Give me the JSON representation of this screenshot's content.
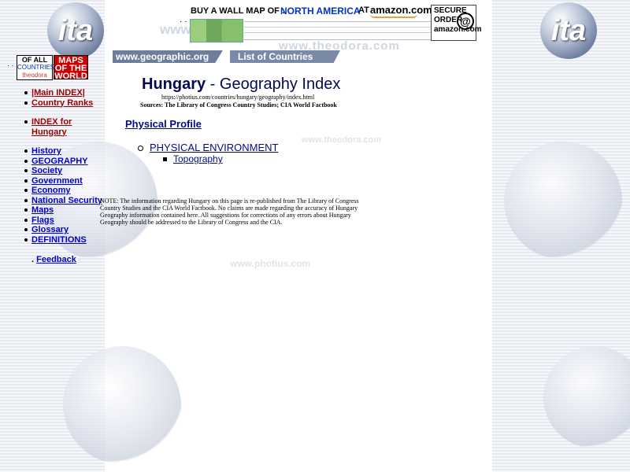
{
  "header": {
    "logo_text": "ita",
    "all_countries": {
      "line1": "OF ALL",
      "line2": "COUNTRIES",
      "line3": "theodora"
    },
    "maps_logo": {
      "line1": "MAPS",
      "line2": "OF THE",
      "line3": "WORLD"
    },
    "banner": {
      "buy_text": "BUY A WALL MAP OF :",
      "region": "NORTH AMERICA",
      "at": "AT",
      "amazon": "amazon.com"
    },
    "secure": {
      "line1": "SECURE",
      "line2": "ORDER",
      "line3": "amazon.com",
      "at_sign": "@"
    },
    "watermark_top": "www.theodora.com",
    "watermark_top_left": "www",
    "tabs": [
      {
        "label": "www.geographic.org"
      },
      {
        "label": "List of Countries"
      }
    ]
  },
  "sidebar": {
    "items": [
      {
        "label": "|Main INDEX|"
      },
      {
        "label": "Country Ranks"
      },
      {
        "label": "INDEX for Hungary"
      },
      {
        "label": "History"
      },
      {
        "label": "GEOGRAPHY"
      },
      {
        "label": "Society"
      },
      {
        "label": "Government"
      },
      {
        "label": "Economy"
      },
      {
        "label": "National Security"
      },
      {
        "label": "Maps"
      },
      {
        "label": "Flags"
      },
      {
        "label": "Glossary"
      },
      {
        "label": "DEFINITIONS"
      }
    ],
    "feedback_prefix": ".",
    "feedback": "Feedback"
  },
  "main": {
    "title_bold": "Hungary",
    "title_rest": " - Geography Index",
    "url": "https://photius.com/countries/hungary/geography/index.html",
    "sources": "Sources: The Library of Congress Country Studies; CIA World Factbook",
    "section_title": "Physical Profile",
    "list": [
      {
        "label": "PHYSICAL ENVIRONMENT",
        "children": [
          {
            "label": "Topography"
          }
        ]
      }
    ],
    "note": "NOTE: The information regarding Hungary on this page is re-published from The Library of Congress Country Studies and the CIA World Factbook. No claims are made regarding the accuracy of Hungary Geography information contained here. All suggestions for corrections of any errors about Hungary Geography should be addressed to the Library of Congress and the CIA.",
    "watermark_mid": "www.theodora.com",
    "watermark_low": "www.photius.com"
  }
}
